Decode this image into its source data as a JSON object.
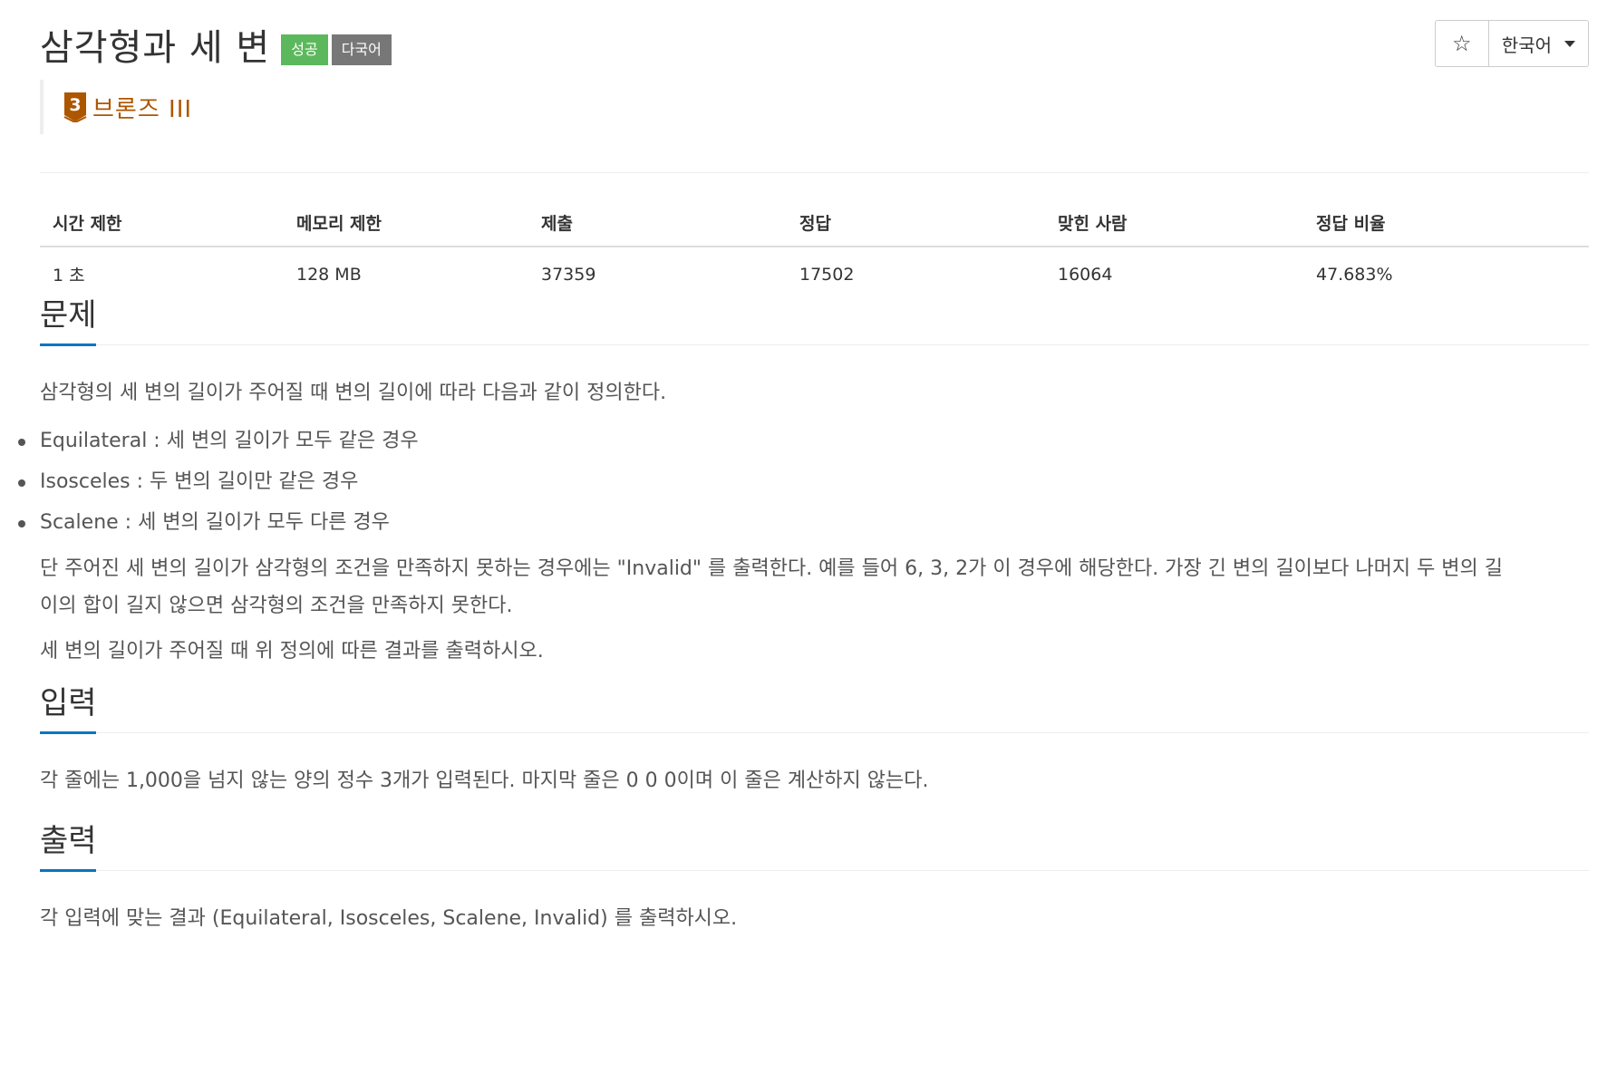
{
  "problem": {
    "title": "삼각형과 세 변",
    "badges": {
      "success": "성공",
      "multilang": "다국어"
    },
    "tier": {
      "label": "브론즈 III",
      "number": "3",
      "color": "#ad5600"
    }
  },
  "controls": {
    "star_icon": "star-outline-icon",
    "language": "한국어"
  },
  "stats": {
    "headers": [
      "시간 제한",
      "메모리 제한",
      "제출",
      "정답",
      "맞힌 사람",
      "정답 비율"
    ],
    "values": [
      "1 초",
      "128 MB",
      "37359",
      "17502",
      "16064",
      "47.683%"
    ]
  },
  "sections": {
    "description": {
      "title": "문제",
      "intro": "삼각형의 세 변의 길이가 주어질 때 변의 길이에 따라 다음과 같이 정의한다.",
      "bullets": [
        "Equilateral :  세 변의 길이가 모두 같은 경우",
        "Isosceles : 두 변의 길이만 같은 경우",
        "Scalene : 세 변의 길이가 모두 다른 경우"
      ],
      "para2_line1": "단 주어진 세 변의 길이가 삼각형의 조건을 만족하지 못하는 경우에는 \"Invalid\" 를 출력한다. 예를 들어 6, 3, 2가 이 경우에 해당한다. 가장 긴 변의 길이보다 나머지 두 변의 길",
      "para2_line2": "이의 합이 길지 않으면 삼각형의 조건을 만족하지 못한다.",
      "para3": "세 변의 길이가 주어질 때 위 정의에 따른 결과를 출력하시오."
    },
    "input": {
      "title": "입력",
      "text": "각 줄에는 1,000을 넘지 않는 양의 정수 3개가 입력된다. 마지막 줄은 0 0 0이며 이 줄은 계산하지 않는다."
    },
    "output": {
      "title": "출력",
      "text": "각 입력에 맞는 결과 (Equilateral, Isosceles, Scalene, Invalid) 를 출력하시오."
    }
  },
  "colors": {
    "accent": "#0076c0",
    "success": "#5cb85c",
    "lang_badge": "#777777"
  }
}
